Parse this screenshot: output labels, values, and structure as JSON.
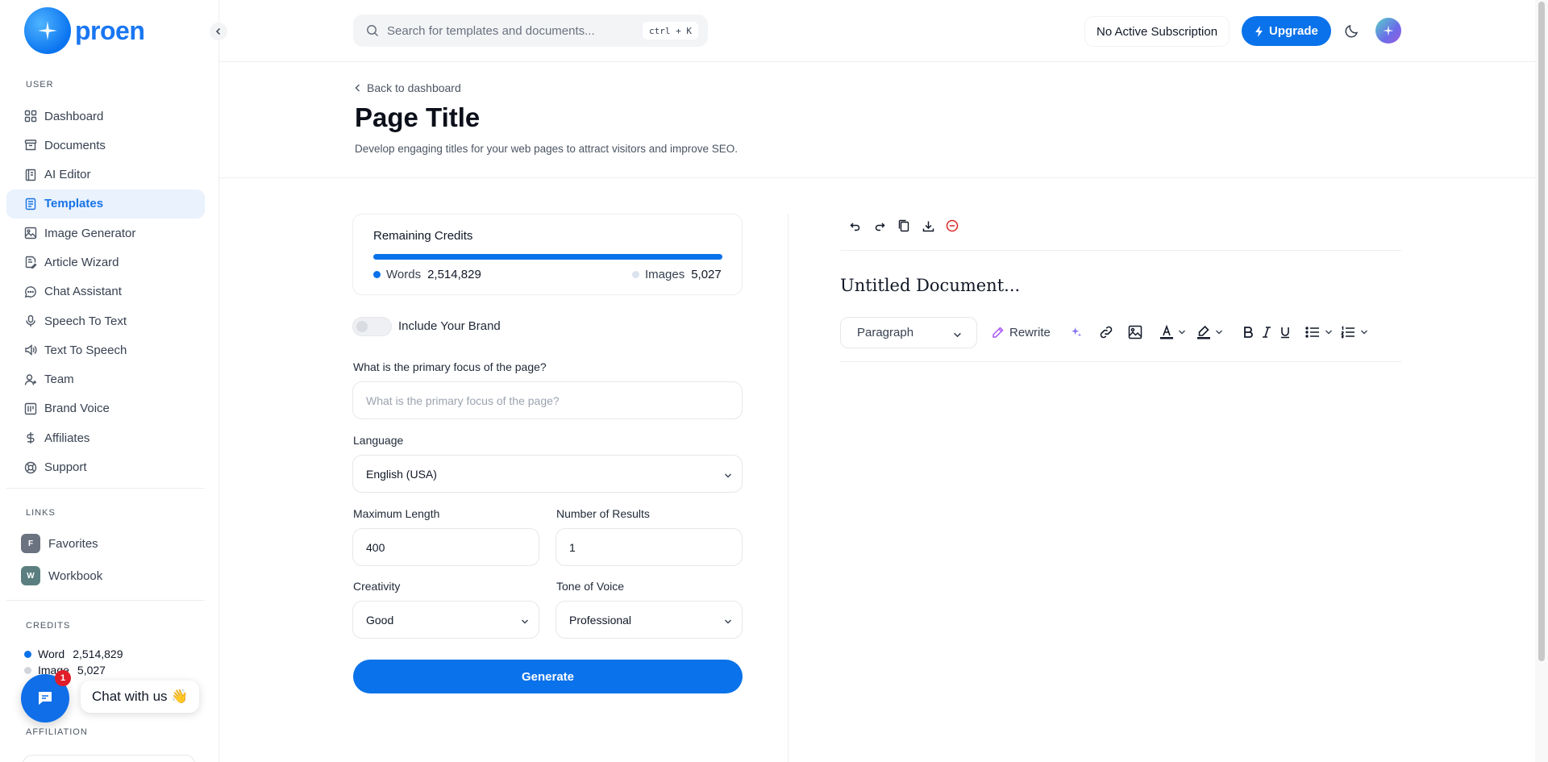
{
  "app": {
    "logo_text": "proen"
  },
  "sidebar": {
    "user_label": "USER",
    "items": [
      {
        "label": "Dashboard",
        "icon": "grid-icon"
      },
      {
        "label": "Documents",
        "icon": "archive-icon"
      },
      {
        "label": "AI Editor",
        "icon": "notebook-icon"
      },
      {
        "label": "Templates",
        "icon": "file-text-icon",
        "active": true
      },
      {
        "label": "Image Generator",
        "icon": "image-icon"
      },
      {
        "label": "Article Wizard",
        "icon": "file-edit-icon"
      },
      {
        "label": "Chat Assistant",
        "icon": "chat-icon"
      },
      {
        "label": "Speech To Text",
        "icon": "mic-icon"
      },
      {
        "label": "Text To Speech",
        "icon": "speaker-icon"
      },
      {
        "label": "Team",
        "icon": "user-plus-icon"
      },
      {
        "label": "Brand Voice",
        "icon": "brand-icon"
      },
      {
        "label": "Affiliates",
        "icon": "dollar-icon"
      },
      {
        "label": "Support",
        "icon": "lifebuoy-icon"
      }
    ],
    "links_label": "LINKS",
    "links": [
      {
        "badge": "F",
        "label": "Favorites",
        "color": "#6b7280"
      },
      {
        "badge": "W",
        "label": "Workbook",
        "color": "#5b7f80"
      }
    ],
    "credits_label": "CREDITS",
    "credits": [
      {
        "label": "Word",
        "value": "2,514,829",
        "color": "#0a72ea"
      },
      {
        "label": "Image",
        "value": "5,027",
        "color": "#d1d5db"
      }
    ],
    "affiliation_label": "AFFILIATION"
  },
  "chat_widget": {
    "badge": "1",
    "text": "Chat with us 👋"
  },
  "topbar": {
    "search_placeholder": "Search for templates and documents...",
    "search_shortcut": "ctrl + K",
    "subscription": "No Active Subscription",
    "upgrade": "Upgrade"
  },
  "page": {
    "back": "Back to dashboard",
    "title": "Page Title",
    "description": "Develop engaging titles for your web pages to attract visitors and improve SEO."
  },
  "form": {
    "remaining_credits": {
      "title": "Remaining Credits",
      "words_label": "Words",
      "words_value": "2,514,829",
      "images_label": "Images",
      "images_value": "5,027"
    },
    "include_brand": {
      "label": "Include Your Brand",
      "enabled": false
    },
    "focus": {
      "label": "What is the primary focus of the page?",
      "placeholder": "What is the primary focus of the page?",
      "value": ""
    },
    "language": {
      "label": "Language",
      "value": "English (USA)"
    },
    "max_length": {
      "label": "Maximum Length",
      "value": "400"
    },
    "num_results": {
      "label": "Number of Results",
      "value": "1"
    },
    "creativity": {
      "label": "Creativity",
      "value": "Good"
    },
    "tone": {
      "label": "Tone of Voice",
      "value": "Professional"
    },
    "generate": "Generate"
  },
  "editor": {
    "document_title": "Untitled Document...",
    "block_type": "Paragraph",
    "rewrite": "Rewrite"
  },
  "colors": {
    "accent": "#0a72ea",
    "danger": "#dc2626"
  }
}
